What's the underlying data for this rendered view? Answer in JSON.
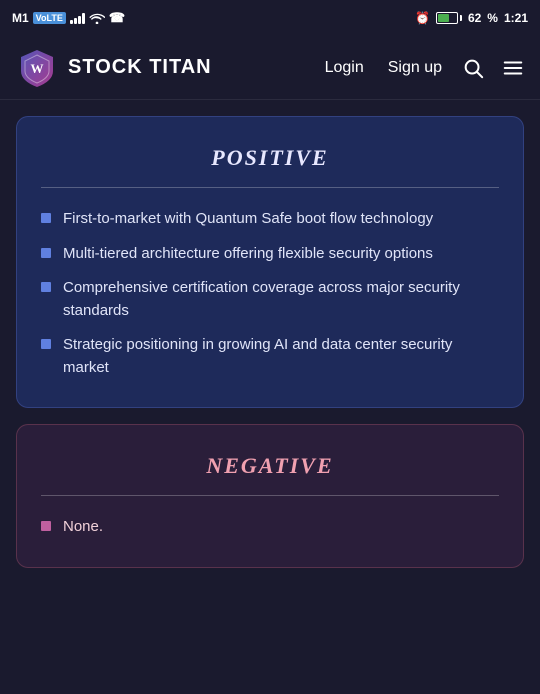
{
  "statusBar": {
    "carrier": "M1",
    "carrierBadge": "VoLTE",
    "time": "1:21",
    "batteryLevel": 62
  },
  "navbar": {
    "logoText": "STOCK TITAN",
    "loginLabel": "Login",
    "signupLabel": "Sign up"
  },
  "positiveCard": {
    "title": "Positive",
    "items": [
      "First-to-market with Quantum Safe boot flow technology",
      "Multi-tiered architecture offering flexible security options",
      "Comprehensive certification coverage across major security standards",
      "Strategic positioning in growing AI and data center security market"
    ]
  },
  "negativeCard": {
    "title": "Negative",
    "items": [
      "None."
    ]
  }
}
